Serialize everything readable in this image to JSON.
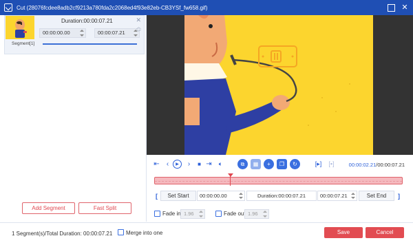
{
  "window": {
    "title": "Cut (28076fcdee8adb2cf9213a780fda2c2068ed4f93e82eb-CB3YSf_fw658.gif)",
    "icons": [
      "cut-app-icon",
      "maximize-icon",
      "close-icon"
    ]
  },
  "segment": {
    "duration": "Duration:00:00:07.21",
    "start": "00:00:00.00",
    "end": "00:00:07.21",
    "label": "Segment[1]"
  },
  "left_buttons": {
    "add_segment": "Add Segment",
    "fast_split": "Fast Split"
  },
  "player": {
    "current_time": "00:00:02.21",
    "total_time": "/00:00:07.21",
    "playhead_fraction": 0.306
  },
  "time_settings": {
    "set_start": "Set Start",
    "start_value": "00:00:00.00",
    "duration": "Duration:00:00:07.21",
    "end_value": "00:00:07.21",
    "set_end": "Set End"
  },
  "fade": {
    "fade_in_label": "Fade in",
    "fade_in_value": "1.96",
    "fade_out_label": "Fade out",
    "fade_out_value": "1.96"
  },
  "footer": {
    "summary": "1 Segment(s)/Total Duration: 00:00:07.21",
    "merge_label": "Merge into one",
    "save": "Save",
    "cancel": "Cancel"
  },
  "colors": {
    "titlebar": "#1f4fb4",
    "accent": "#2b5fd9",
    "danger": "#e24c52",
    "video_bg": "#fcd52e"
  }
}
